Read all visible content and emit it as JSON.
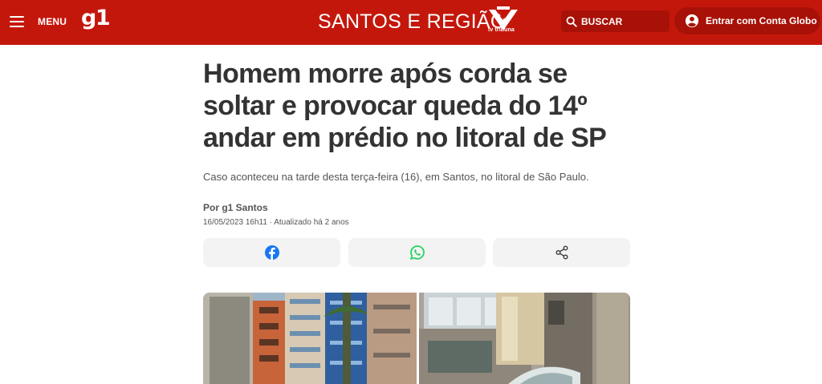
{
  "header": {
    "menu_label": "MENU",
    "logo_text": "g1",
    "region_title": "SANTOS E REGIÃO",
    "affiliate_logo_text": "tv tribuna",
    "search_label": "BUSCAR",
    "login_label": "Entrar com Conta Globo",
    "brand_color": "#c4170c"
  },
  "article": {
    "title": "Homem morre após corda se soltar e provocar queda do 14º andar em prédio no litoral de SP",
    "subtitle": "Caso aconteceu na tarde desta terça-feira (16), em Santos, no litoral de São Paulo.",
    "byline": "Por g1 Santos",
    "dateline": "16/05/2023 16h11 · Atualizado há 2 anos"
  },
  "share": {
    "buttons": [
      {
        "icon": "facebook-icon",
        "color": "#1877f2"
      },
      {
        "icon": "whatsapp-icon",
        "color": "#25d366"
      },
      {
        "icon": "share-icon",
        "color": "#444444"
      }
    ]
  },
  "media": {
    "photos": [
      "building-photo-left",
      "building-photo-right"
    ]
  }
}
